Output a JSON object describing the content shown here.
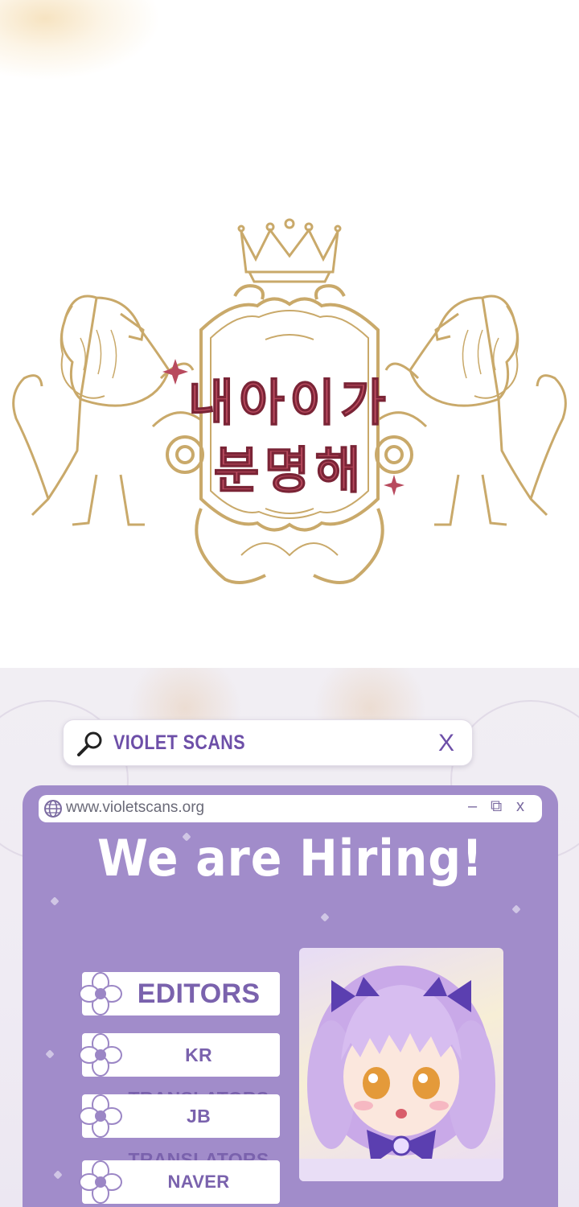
{
  "title": {
    "line1": "내아이가",
    "line2": "분명해"
  },
  "banner": {
    "search": {
      "text": "VIOLET SCANS",
      "icon": "search-icon",
      "close": "X"
    },
    "browser": {
      "url": "www.violetscans.org",
      "minimize": "–",
      "restore": "⧉",
      "close": "x"
    },
    "headline": "We are Hiring!",
    "roles": [
      "EDITORS",
      "KR TRANSLATORS",
      "JB TRANSLATORS",
      "NAVER PROVIDERS"
    ],
    "colors": {
      "accent": "#6d4fa8",
      "panel": "#a18cca",
      "title": "#b84a5e",
      "gold": "#c9a96a"
    }
  }
}
